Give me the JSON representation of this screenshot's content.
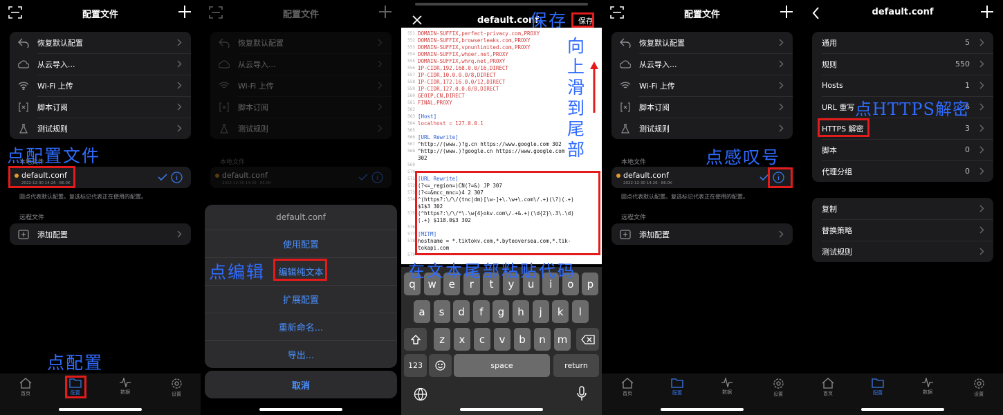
{
  "colors": {
    "accent": "#3b78e8",
    "annotation": "#2f6bff",
    "highlight": "#e31b1b",
    "code_red": "#d23a3a",
    "code_blue": "#2a5ad0"
  },
  "common": {
    "title_profiles": "配置文件",
    "menu": [
      {
        "icon": "undo-icon",
        "label": "恢复默认配置"
      },
      {
        "icon": "cloud-icon",
        "label": "从云导入..."
      },
      {
        "icon": "wifi-icon",
        "label": "Wi-Fi 上传"
      },
      {
        "icon": "script-icon",
        "label": "脚本订阅"
      },
      {
        "icon": "flask-icon",
        "label": "测试规则"
      }
    ],
    "local_files_label": "本地文件",
    "file_name": "default.conf",
    "file_meta": "2022-12-30 14:26 · 86.0K",
    "note": "圆点代表默认配置。复选标记代表正在使用的配置。",
    "remote_files_label": "远程文件",
    "add_config": "添加配置",
    "tabs": [
      "首页",
      "配置",
      "数据",
      "设置"
    ]
  },
  "sheet": {
    "title": "default.conf",
    "actions": [
      "使用配置",
      "编辑纯文本",
      "扩展配置",
      "重新命名...",
      "导出..."
    ],
    "cancel": "取消"
  },
  "editor": {
    "title": "default.conf",
    "save": "保存",
    "lines": [
      {
        "n": "551",
        "t": "DOMAIN-SUFFIX,perfect-privacy.com,PROXY",
        "c": "red"
      },
      {
        "n": "552",
        "t": "DOMAIN-SUFFIX,browserleaks.com,PROXY",
        "c": "red"
      },
      {
        "n": "553",
        "t": "DOMAIN-SUFFIX,vpnunlimited.com,PROXY",
        "c": "red"
      },
      {
        "n": "554",
        "t": "DOMAIN-SUFFIX,whoer.net,PROXY",
        "c": "red"
      },
      {
        "n": "555",
        "t": "DOMAIN-SUFFIX,whrq.net,PROXY",
        "c": "red"
      },
      {
        "n": "556",
        "t": "IP-CIDR,192.168.0.0/16,DIRECT",
        "c": "red"
      },
      {
        "n": "557",
        "t": "IP-CIDR,10.0.0.0/8,DIRECT",
        "c": "red"
      },
      {
        "n": "558",
        "t": "IP-CIDR,172.16.0.0/12,DIRECT",
        "c": "red"
      },
      {
        "n": "559",
        "t": "IP-CIDR,127.0.0.0/8,DIRECT",
        "c": "red"
      },
      {
        "n": "560",
        "t": "GEOIP,CN,DIRECT",
        "c": "red"
      },
      {
        "n": "561",
        "t": "FINAL,PROXY",
        "c": "red"
      },
      {
        "n": "562",
        "t": "",
        "c": "black"
      },
      {
        "n": "563",
        "t": "[Host]",
        "c": "blue"
      },
      {
        "n": "564",
        "t": "localhost = 127.0.0.1",
        "c": "red"
      },
      {
        "n": "565",
        "t": "",
        "c": "black"
      },
      {
        "n": "566",
        "t": "[URL Rewrite]",
        "c": "blue"
      },
      {
        "n": "567",
        "t": "^http://(www.)?g.cn https://www.google.com 302",
        "c": "black"
      },
      {
        "n": "568",
        "t": "^http://(www.)?google.cn https://www.google.com",
        "c": "black"
      },
      {
        "n": "",
        "t": "302",
        "c": "black"
      },
      {
        "n": "569",
        "t": "",
        "c": "black"
      },
      {
        "n": "570",
        "t": "",
        "c": "black"
      },
      {
        "n": "571",
        "t": "[URL Rewrite]",
        "c": "blue"
      },
      {
        "n": "572",
        "t": "(?<=_region=)CN(?=&) JP 307",
        "c": "black"
      },
      {
        "n": "573",
        "t": "(?<=&mcc_mnc=)4 2 307",
        "c": "black"
      },
      {
        "n": "574",
        "t": "^(https?:\\/\\/(tnc|dm)[\\w-]+\\.\\w+\\.com\\/.+)(\\?)(.+)",
        "c": "black"
      },
      {
        "n": "",
        "t": "$1$3 302",
        "c": "black"
      },
      {
        "n": "575",
        "t": "(^https?:\\/\\/*\\.\\w{4}okv.com\\/.+&.+)(\\d{2}\\.3\\.\\d)",
        "c": "black"
      },
      {
        "n": "",
        "t": "(.+) $118.0$3 302",
        "c": "black"
      },
      {
        "n": "576",
        "t": "",
        "c": "black"
      },
      {
        "n": "577",
        "t": "[MITM]",
        "c": "blue"
      },
      {
        "n": "578",
        "t": "hostname = *.tiktokv.com,*.byteoversea.com,*.tik-",
        "c": "black"
      },
      {
        "n": "",
        "t": "tokapi.com",
        "c": "black"
      },
      {
        "n": "579",
        "t": "",
        "c": "black"
      }
    ],
    "keyboard": {
      "row1": [
        "q",
        "w",
        "e",
        "r",
        "t",
        "y",
        "u",
        "i",
        "o",
        "p"
      ],
      "row2": [
        "a",
        "s",
        "d",
        "f",
        "g",
        "h",
        "j",
        "k",
        "l"
      ],
      "row3": [
        "z",
        "x",
        "c",
        "v",
        "b",
        "n",
        "m"
      ],
      "num": "123",
      "space": "space",
      "return": "return"
    }
  },
  "detail": {
    "title": "default.conf",
    "rows": [
      {
        "label": "通用",
        "value": "5"
      },
      {
        "label": "规则",
        "value": "550"
      },
      {
        "label": "Hosts",
        "value": "1"
      },
      {
        "label": "URL 重写",
        "value": "6"
      },
      {
        "label": "HTTPS 解密",
        "value": "3"
      },
      {
        "label": "脚本",
        "value": "0"
      },
      {
        "label": "代理分组",
        "value": "0"
      }
    ],
    "rows2": [
      "复制",
      "替换策略",
      "测试规则"
    ]
  },
  "annotations": {
    "p1_file": "点配置文件",
    "p1_tab": "点配置",
    "p2_edit": "点编辑",
    "p3_save": "保存",
    "p3_scroll": [
      "向",
      "上",
      "滑",
      "到",
      "尾",
      "部"
    ],
    "p3_paste": "在文本尾部粘贴代码",
    "p4_info": "点感叹号",
    "p5_https": "点HTTPS解密"
  }
}
